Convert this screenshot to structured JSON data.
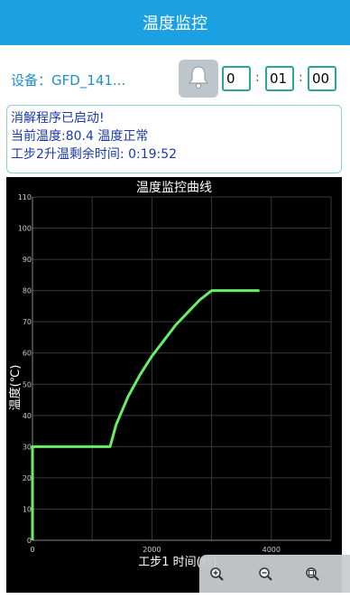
{
  "title": "温度监控",
  "device": {
    "label": "设备：GFD_141..."
  },
  "timer": {
    "h": "0",
    "m": "01",
    "s": "00",
    "sep": ":"
  },
  "status": {
    "line1": "消解程序已启动!",
    "line2": "当前温度:80.4 温度正常",
    "line3": "工步2升温剩余时间: 0:19:52"
  },
  "chart_data": {
    "type": "line",
    "title": "温度监控曲线",
    "xlabel": "工步1 时间(秒)",
    "ylabel": "温度(℃)",
    "xlim": [
      0,
      5000
    ],
    "ylim": [
      0,
      110
    ],
    "x_ticks": [
      "0",
      "2000",
      "4000"
    ],
    "y_ticks": [
      "0",
      "10",
      "20",
      "30",
      "40",
      "50",
      "60",
      "70",
      "80",
      "90",
      "100",
      "110"
    ],
    "series": [
      {
        "color": "#66ee66",
        "x": [
          0,
          0,
          1300,
          1400,
          1600,
          1800,
          2000,
          2200,
          2400,
          2600,
          2800,
          3000,
          3800
        ],
        "y": [
          0,
          30,
          30,
          37,
          46,
          53,
          59,
          64,
          69,
          73,
          77,
          80,
          80
        ]
      }
    ],
    "grid": true
  },
  "icons": {
    "bell": "bell-icon",
    "zoom_in": "zoom-in-icon",
    "zoom_out": "zoom-out-icon",
    "zoom_reset": "zoom-reset-icon"
  },
  "colors": {
    "titlebar": "#1ba1e2",
    "accent": "#2aa59a",
    "status_text": "#1b3aa8",
    "curve": "#66ee66"
  }
}
